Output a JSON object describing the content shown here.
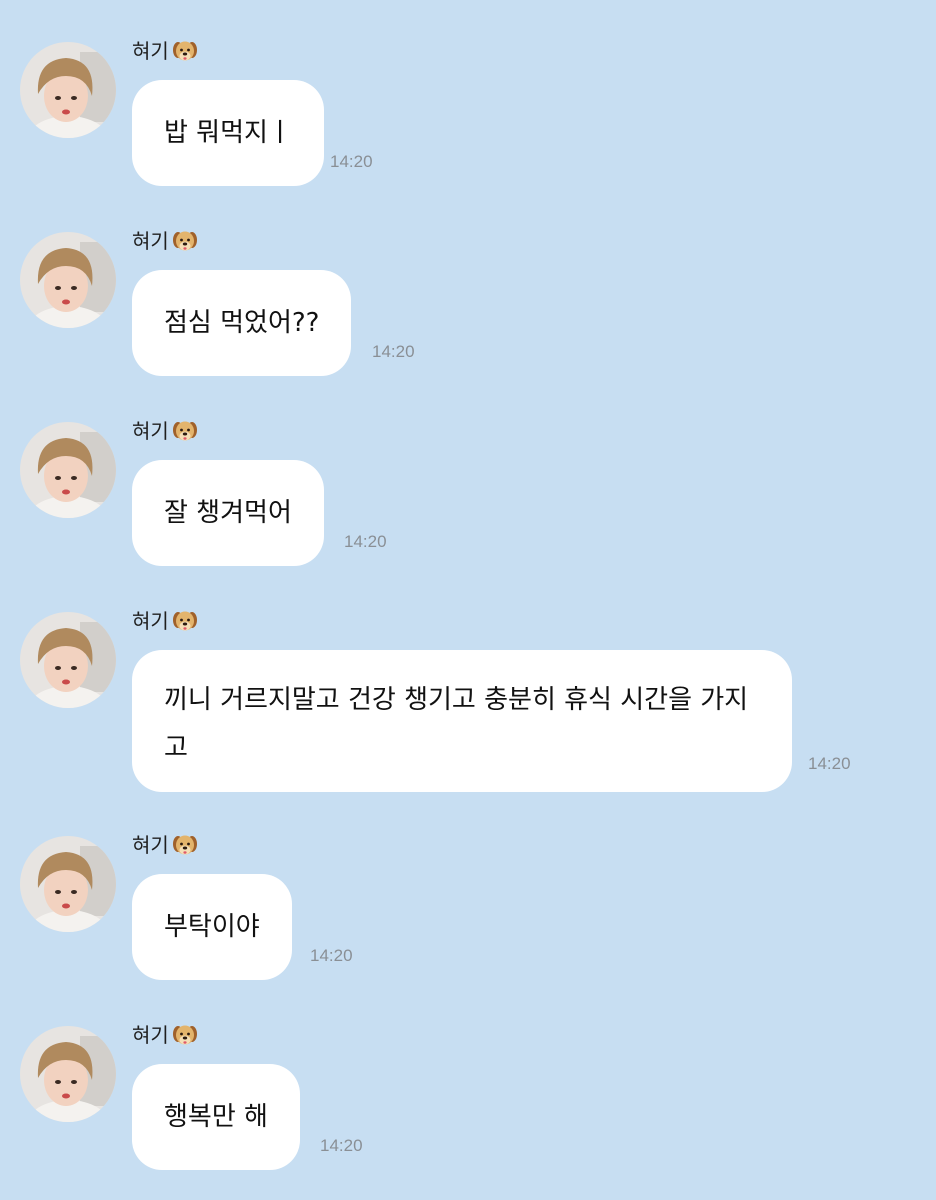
{
  "conversation": {
    "sender_name": "혀기",
    "sender_emoji_icon": "dog-face-icon",
    "colors": {
      "background": "#c7def2",
      "bubble": "#ffffff",
      "timestamp": "#8a8f95"
    },
    "messages": [
      {
        "text": "밥 뭐먹지ㅣ",
        "time": "14:20"
      },
      {
        "text": "점심 먹었어??",
        "time": "14:20"
      },
      {
        "text": "잘 챙겨먹어",
        "time": "14:20"
      },
      {
        "text": "끼니 거르지말고 건강 챙기고 충분히 휴식 시간을 가지고",
        "time": "14:20"
      },
      {
        "text": "부탁이야",
        "time": "14:20"
      },
      {
        "text": "행복만 해",
        "time": "14:20"
      }
    ]
  }
}
